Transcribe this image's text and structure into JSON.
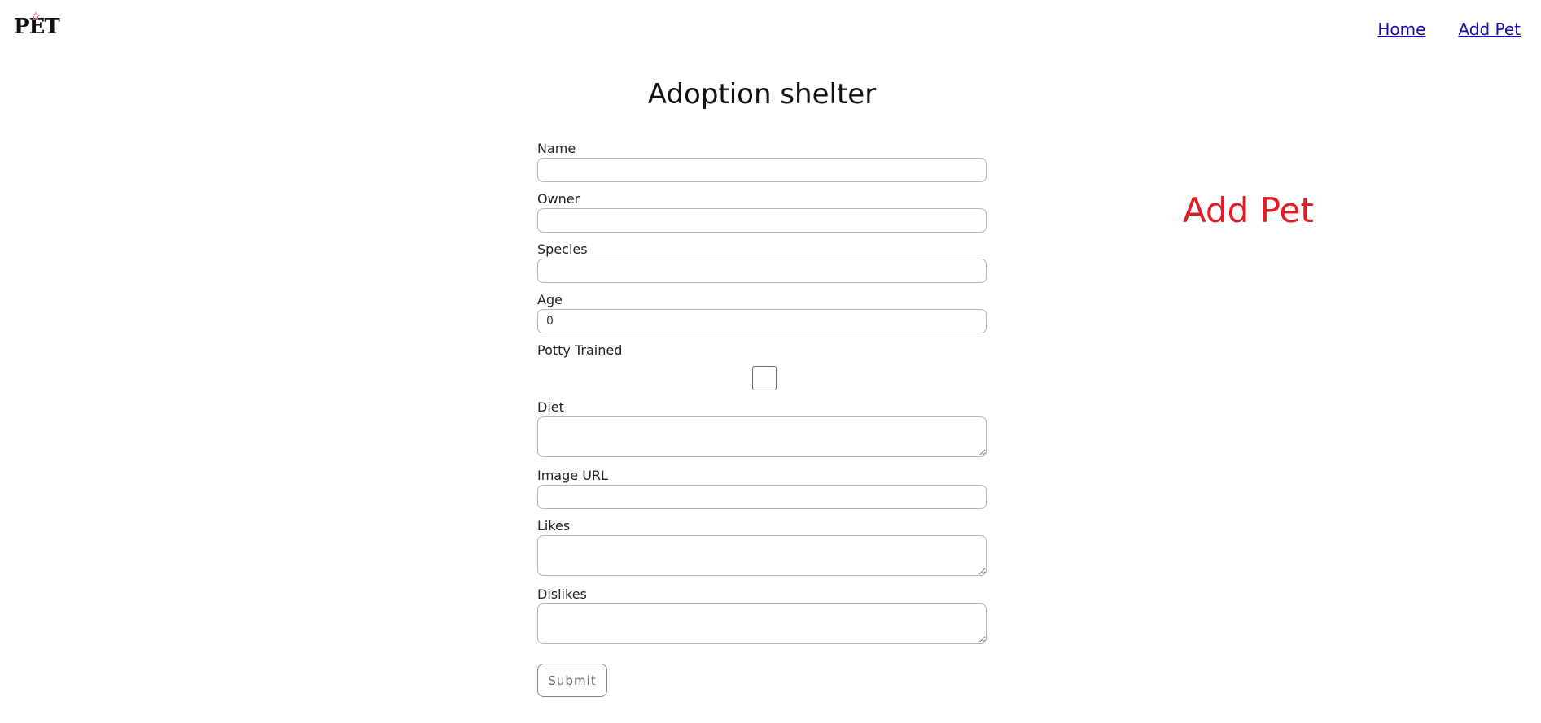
{
  "brand": {
    "logo_text": "PET",
    "star_glyph": "✩"
  },
  "nav": {
    "home_label": "Home",
    "add_pet_label": "Add Pet"
  },
  "page": {
    "title": "Adoption shelter",
    "side_heading": "Add Pet"
  },
  "form": {
    "name_label": "Name",
    "owner_label": "Owner",
    "species_label": "Species",
    "age_label": "Age",
    "age_value": "0",
    "potty_label": "Potty Trained",
    "diet_label": "Diet",
    "image_url_label": "Image URL",
    "likes_label": "Likes",
    "dislikes_label": "Dislikes",
    "submit_label": "Submit"
  },
  "colors": {
    "accent_red": "#e01b24",
    "link_blue": "#1a0dab"
  }
}
